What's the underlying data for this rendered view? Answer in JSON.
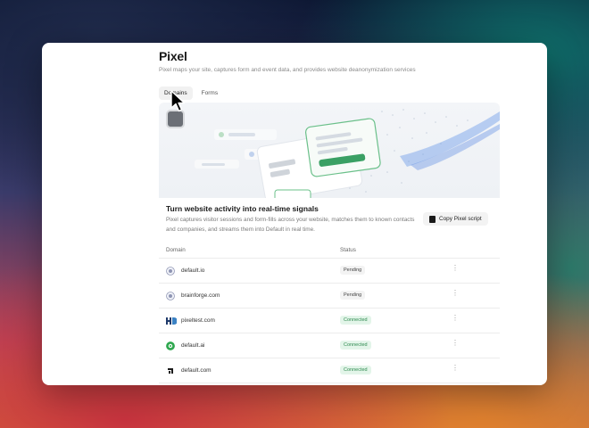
{
  "page": {
    "title": "Pixel",
    "subtitle": "Pixel maps your site, captures form and event data, and provides website deanonymization services"
  },
  "tabs": [
    {
      "label": "Domains",
      "active": true
    },
    {
      "label": "Forms",
      "active": false
    }
  ],
  "card": {
    "title": "Turn website activity into real-time signals",
    "description": "Pixel captures visitor sessions and form-fills across your website, matches them to known contacts and companies, and streams them into Default in real time.",
    "copy_button_label": "Copy Pixel script",
    "copy_icon": "clipboard-icon"
  },
  "table": {
    "headers": {
      "domain": "Domain",
      "status": "Status"
    },
    "rows": [
      {
        "domain": "default.io",
        "status": "Pending",
        "status_type": "pending",
        "icon": "globe-icon"
      },
      {
        "domain": "brainforge.com",
        "status": "Pending",
        "status_type": "pending",
        "icon": "globe-icon"
      },
      {
        "domain": "pixeltest.com",
        "status": "Connected",
        "status_type": "connected",
        "icon": "hd-logo-icon"
      },
      {
        "domain": "default.ai",
        "status": "Connected",
        "status_type": "connected",
        "icon": "green-logo-icon"
      },
      {
        "domain": "default.com",
        "status": "Connected",
        "status_type": "connected",
        "icon": "default-logo-icon"
      }
    ]
  },
  "colors": {
    "connected_bg": "#e3f5e9",
    "connected_text": "#2f8a50",
    "pending_bg": "#f3f3f3",
    "accent_green": "#3aa064"
  }
}
